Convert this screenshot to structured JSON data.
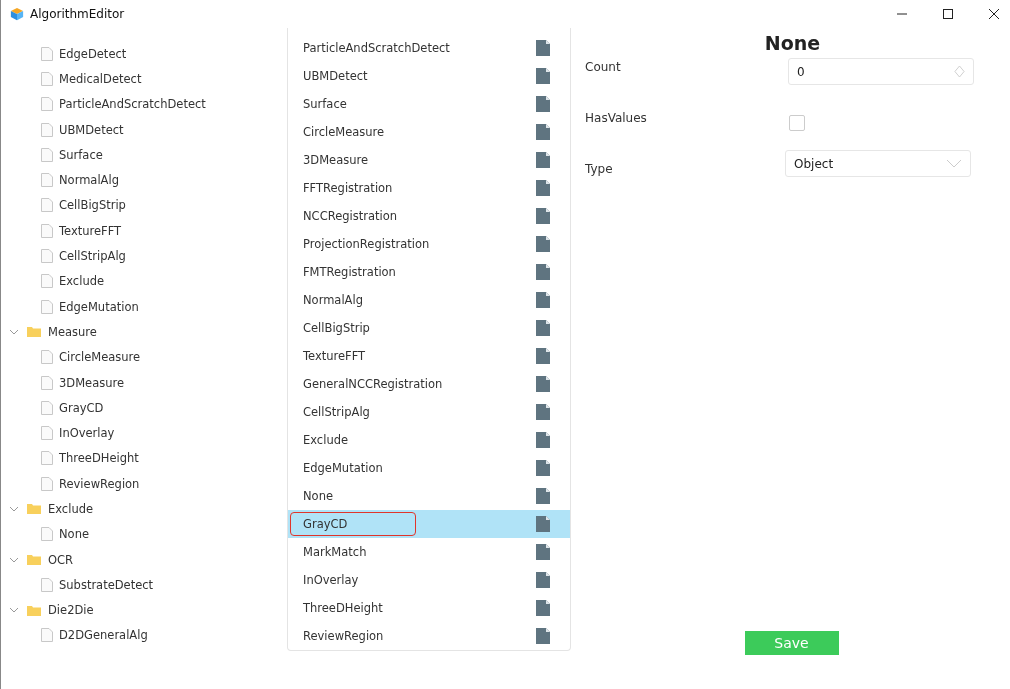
{
  "window": {
    "title": "AlgorithmEditor"
  },
  "tree": {
    "loose_items": [
      "EdgeDetect",
      "MedicalDetect",
      "ParticleAndScratchDetect",
      "UBMDetect",
      "Surface",
      "NormalAlg",
      "CellBigStrip",
      "TextureFFT",
      "CellStripAlg",
      "Exclude",
      "EdgeMutation"
    ],
    "folders": [
      {
        "label": "Measure",
        "expanded": true,
        "children": [
          "CircleMeasure",
          "3DMeasure",
          "GrayCD",
          "InOverlay",
          "ThreeDHeight",
          "ReviewRegion"
        ]
      },
      {
        "label": "Exclude",
        "expanded": true,
        "children": [
          "None"
        ]
      },
      {
        "label": "OCR",
        "expanded": true,
        "children": [
          "SubstrateDetect"
        ]
      },
      {
        "label": "Die2Die",
        "expanded": true,
        "children": [
          "D2DGeneralAlg"
        ]
      }
    ]
  },
  "algorithm_list": [
    {
      "label": "ParticleAndScratchDetect",
      "selected": false
    },
    {
      "label": "UBMDetect",
      "selected": false
    },
    {
      "label": "Surface",
      "selected": false
    },
    {
      "label": "CircleMeasure",
      "selected": false
    },
    {
      "label": "3DMeasure",
      "selected": false
    },
    {
      "label": "FFTRegistration",
      "selected": false
    },
    {
      "label": "NCCRegistration",
      "selected": false
    },
    {
      "label": "ProjectionRegistration",
      "selected": false
    },
    {
      "label": "FMTRegistration",
      "selected": false
    },
    {
      "label": "NormalAlg",
      "selected": false
    },
    {
      "label": "CellBigStrip",
      "selected": false
    },
    {
      "label": "TextureFFT",
      "selected": false
    },
    {
      "label": "GeneralNCCRegistration",
      "selected": false
    },
    {
      "label": "CellStripAlg",
      "selected": false
    },
    {
      "label": "Exclude",
      "selected": false
    },
    {
      "label": "EdgeMutation",
      "selected": false
    },
    {
      "label": "None",
      "selected": false
    },
    {
      "label": "GrayCD",
      "selected": true
    },
    {
      "label": "MarkMatch",
      "selected": false
    },
    {
      "label": "InOverlay",
      "selected": false
    },
    {
      "label": "ThreeDHeight",
      "selected": false
    },
    {
      "label": "ReviewRegion",
      "selected": false
    }
  ],
  "properties": {
    "title": "None",
    "fields": [
      {
        "kind": "number",
        "label": "Count",
        "value": "0"
      },
      {
        "kind": "checkbox",
        "label": "HasValues",
        "checked": false
      },
      {
        "kind": "dropdown",
        "label": "Type",
        "value": "Object"
      }
    ]
  },
  "save_button": "Save"
}
